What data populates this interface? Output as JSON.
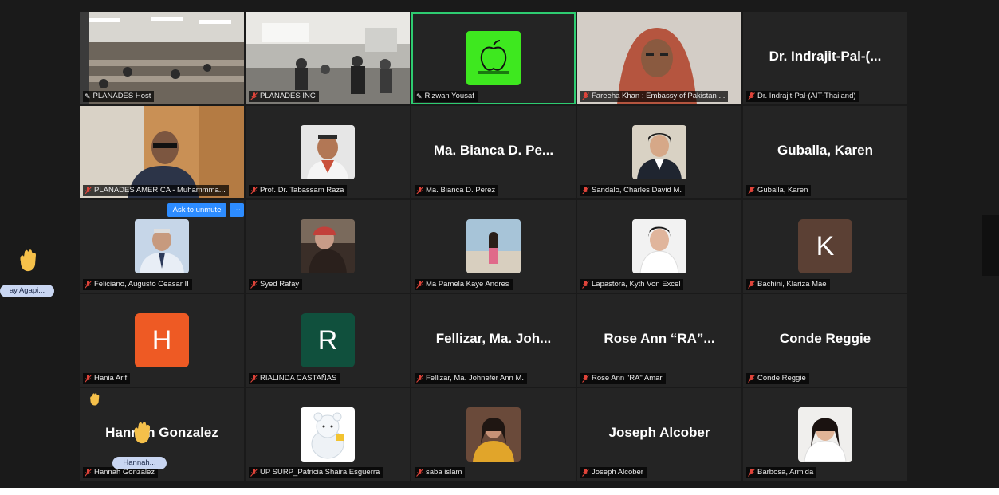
{
  "meeting": {
    "ask_to_unmute": "Ask to unmute",
    "more_glyph": "…",
    "side_participant": "ay Agapi...",
    "hover_participant": "Hannah..."
  },
  "colors": {
    "background": "#1a1a1a",
    "tile": "#242424",
    "active_border": "#2ecc71",
    "muted_mic": "#e0443a",
    "button": "#2d8cff"
  },
  "tiles": [
    {
      "label": "PLANADES Host",
      "display": "",
      "letter": "",
      "pinned": true,
      "muted": false
    },
    {
      "label": "PLANADES INC",
      "display": "",
      "letter": "",
      "pinned": false,
      "muted": true
    },
    {
      "label": "Rizwan Yousaf",
      "display": "",
      "letter": "",
      "pinned": true,
      "muted": false
    },
    {
      "label": "Fareeha Khan : Embassy of Pakistan ...",
      "display": "",
      "letter": "",
      "pinned": false,
      "muted": true
    },
    {
      "label": "Dr. Indrajit-Pal-(AIT-Thailand)",
      "display": "Dr. Indrajit-Pal-(...",
      "letter": "",
      "pinned": false,
      "muted": true
    },
    {
      "label": "PLANADES AMERICA - Muhammma...",
      "display": "",
      "letter": "",
      "pinned": false,
      "muted": true
    },
    {
      "label": "Prof. Dr. Tabassam Raza",
      "display": "",
      "letter": "",
      "pinned": false,
      "muted": true
    },
    {
      "label": "Ma. Bianca D. Perez",
      "display": "Ma. Bianca D. Pe...",
      "letter": "",
      "pinned": false,
      "muted": true
    },
    {
      "label": "Sandalo, Charles David M.",
      "display": "",
      "letter": "",
      "pinned": false,
      "muted": true
    },
    {
      "label": "Guballa, Karen",
      "display": "Guballa, Karen",
      "letter": "",
      "pinned": false,
      "muted": true
    },
    {
      "label": "Feliciano, Augusto Ceasar II",
      "display": "",
      "letter": "",
      "pinned": false,
      "muted": true
    },
    {
      "label": "Syed Rafay",
      "display": "",
      "letter": "",
      "pinned": false,
      "muted": true
    },
    {
      "label": "Ma Pamela Kaye Andres",
      "display": "",
      "letter": "",
      "pinned": false,
      "muted": true
    },
    {
      "label": "Lapastora, Kyth Von Excel",
      "display": "",
      "letter": "",
      "pinned": false,
      "muted": true
    },
    {
      "label": "Bachini, Klariza Mae",
      "display": "",
      "letter": "K",
      "pinned": false,
      "muted": true
    },
    {
      "label": "Hania Arif",
      "display": "",
      "letter": "H",
      "pinned": false,
      "muted": true
    },
    {
      "label": "RIALINDA CASTAÑAS",
      "display": "",
      "letter": "R",
      "pinned": false,
      "muted": true
    },
    {
      "label": "Fellizar, Ma. Johnefer Ann M.",
      "display": "Fellizar, Ma. Joh...",
      "letter": "",
      "pinned": false,
      "muted": true
    },
    {
      "label": "Rose Ann \"RA\" Amar",
      "display": "Rose Ann “RA”...",
      "letter": "",
      "pinned": false,
      "muted": true
    },
    {
      "label": "Conde Reggie",
      "display": "Conde Reggie",
      "letter": "",
      "pinned": false,
      "muted": true
    },
    {
      "label": "Hannah Gonzalez",
      "display": "Hannah Gonzalez",
      "letter": "",
      "pinned": false,
      "muted": true
    },
    {
      "label": "UP SURP_Patricia Shaira Esguerra",
      "display": "",
      "letter": "",
      "pinned": false,
      "muted": true
    },
    {
      "label": "saba islam",
      "display": "",
      "letter": "",
      "pinned": false,
      "muted": true
    },
    {
      "label": "Joseph Alcober",
      "display": "Joseph Alcober",
      "letter": "",
      "pinned": false,
      "muted": true
    },
    {
      "label": "Barbosa, Armida",
      "display": "",
      "letter": "",
      "pinned": false,
      "muted": true
    }
  ]
}
